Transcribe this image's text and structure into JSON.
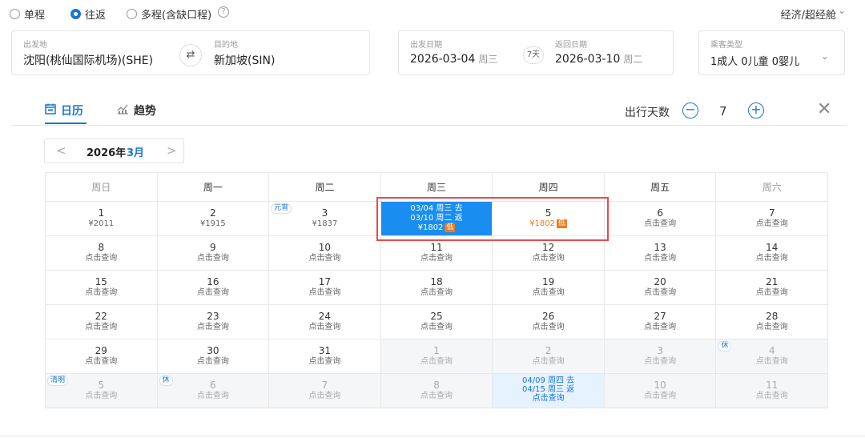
{
  "trip_types": [
    {
      "label": "单程",
      "selected": false
    },
    {
      "label": "往返",
      "selected": true
    },
    {
      "label": "多程(含缺口程)",
      "selected": false
    }
  ],
  "help_icon": "?",
  "cabin": "经济/超经舱",
  "cabin_chevron": "⌄",
  "search": {
    "from_label": "出发地",
    "from_value": "沈阳(桃仙国际机场)(SHE)",
    "to_label": "目的地",
    "to_value": "新加坡(SIN)",
    "swap_icon": "⇄",
    "depart_label": "出发日期",
    "depart_value": "2026-03-04",
    "depart_week": "周三",
    "days_badge": "7天",
    "return_label": "返回日期",
    "return_value": "2026-03-10",
    "return_week": "周二",
    "pax_label": "乘客类型",
    "pax_value": "1成人  0儿童  0婴儿",
    "pax_chevron": "⌄"
  },
  "tabs": [
    {
      "label": "日历",
      "icon": "calendar-icon",
      "active": true
    },
    {
      "label": "趋势",
      "icon": "trend-chart-icon",
      "active": false
    }
  ],
  "trip_days": {
    "label": "出行天数",
    "minus": "−",
    "value": "7",
    "plus": "+"
  },
  "close_icon": "✕",
  "month_nav": {
    "prev": "<",
    "year": "2026年",
    "month": "3月",
    "next": ">"
  },
  "weekdays": [
    "周日",
    "周一",
    "周二",
    "周三",
    "周四",
    "周五",
    "周六"
  ],
  "rows": [
    [
      {
        "n": "1",
        "p": "¥2011"
      },
      {
        "n": "2",
        "p": "¥1915"
      },
      {
        "n": "3",
        "p": "¥1837",
        "tag": "元宵"
      },
      {
        "type": "sel",
        "lines": [
          "03/04 周三 去",
          "03/10 周二 返",
          "¥1802"
        ],
        "low": "低"
      },
      {
        "n": "5",
        "p": "¥1802",
        "orange": true,
        "low": "低"
      },
      {
        "n": "6",
        "p": "点击查询"
      },
      {
        "n": "7",
        "p": "点击查询"
      }
    ],
    [
      {
        "n": "8",
        "p": "点击查询"
      },
      {
        "n": "9",
        "p": "点击查询"
      },
      {
        "n": "10",
        "p": "点击查询"
      },
      {
        "n": "11",
        "p": "点击查询"
      },
      {
        "n": "12",
        "p": "点击查询"
      },
      {
        "n": "13",
        "p": "点击查询"
      },
      {
        "n": "14",
        "p": "点击查询"
      }
    ],
    [
      {
        "n": "15",
        "p": "点击查询"
      },
      {
        "n": "16",
        "p": "点击查询"
      },
      {
        "n": "17",
        "p": "点击查询"
      },
      {
        "n": "18",
        "p": "点击查询"
      },
      {
        "n": "19",
        "p": "点击查询"
      },
      {
        "n": "20",
        "p": "点击查询"
      },
      {
        "n": "21",
        "p": "点击查询"
      }
    ],
    [
      {
        "n": "22",
        "p": "点击查询"
      },
      {
        "n": "23",
        "p": "点击查询"
      },
      {
        "n": "24",
        "p": "点击查询"
      },
      {
        "n": "25",
        "p": "点击查询"
      },
      {
        "n": "26",
        "p": "点击查询"
      },
      {
        "n": "27",
        "p": "点击查询"
      },
      {
        "n": "28",
        "p": "点击查询"
      }
    ],
    [
      {
        "n": "29",
        "p": "点击查询"
      },
      {
        "n": "30",
        "p": "点击查询"
      },
      {
        "n": "31",
        "p": "点击查询"
      },
      {
        "n": "1",
        "p": "点击查询",
        "other": true
      },
      {
        "n": "2",
        "p": "点击查询",
        "other": true
      },
      {
        "n": "3",
        "p": "点击查询",
        "other": true
      },
      {
        "n": "4",
        "p": "点击查询",
        "other": true,
        "tag": "休"
      }
    ],
    [
      {
        "n": "5",
        "p": "点击查询",
        "other": true,
        "tag": "清明"
      },
      {
        "n": "6",
        "p": "点击查询",
        "other": true,
        "tag": "休"
      },
      {
        "n": "7",
        "p": "点击查询",
        "other": true
      },
      {
        "n": "8",
        "p": "点击查询",
        "other": true
      },
      {
        "type": "range2",
        "lines": [
          "04/09 周四 去",
          "04/15 周三 返",
          "点击查询"
        ]
      },
      {
        "n": "10",
        "p": "点击查询",
        "other": true
      },
      {
        "n": "11",
        "p": "点击查询",
        "other": true
      }
    ]
  ]
}
